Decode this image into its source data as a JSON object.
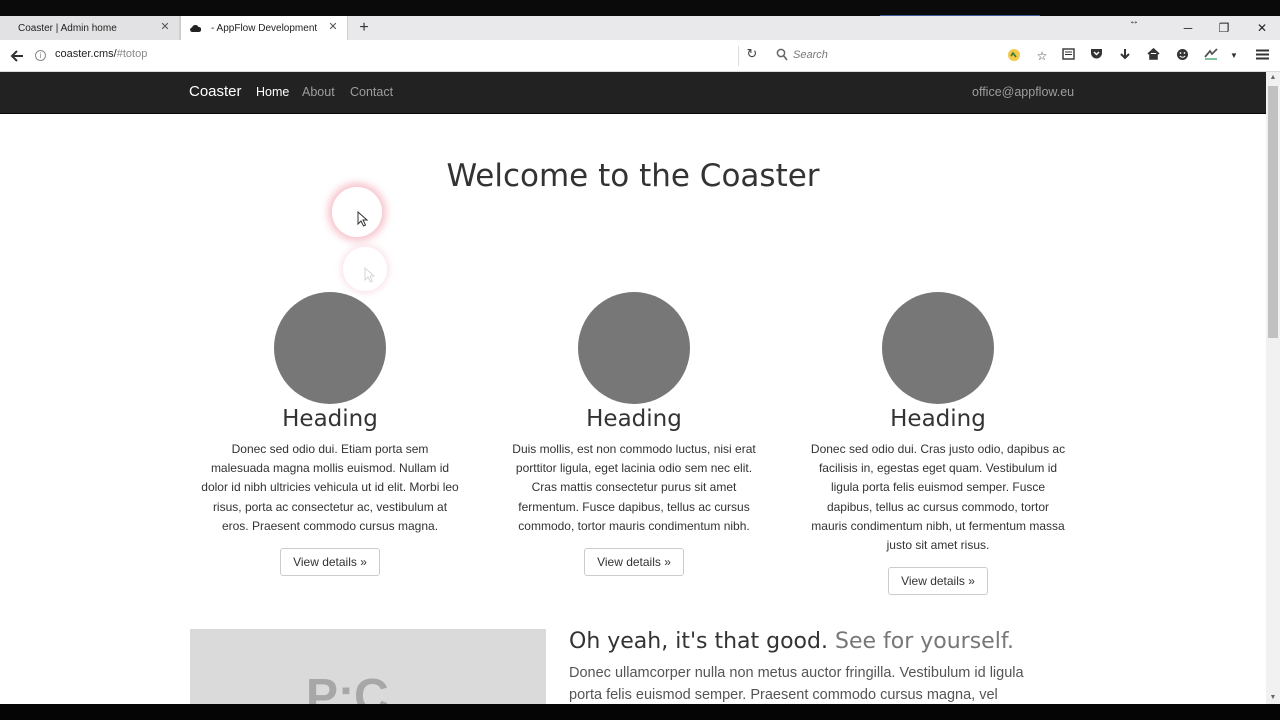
{
  "browser": {
    "tabs": [
      {
        "title": "Coaster | Admin home",
        "active": false
      },
      {
        "title": "- AppFlow Development",
        "active": true
      }
    ],
    "url": {
      "host": "coaster.cms/",
      "fragment": "#totop"
    },
    "search_placeholder": "Search",
    "icons": {
      "back": "back-arrow-icon",
      "reload": "reload-icon",
      "new_tab": "plus-icon",
      "toolbar": [
        "extension-icon",
        "bookmark-star-icon",
        "reading-list-icon",
        "pocket-icon",
        "download-icon",
        "home-icon",
        "smiley-icon",
        "extension-icon",
        "dropdown-icon",
        "menu-icon"
      ]
    }
  },
  "site": {
    "brand": "Coaster",
    "nav": [
      {
        "label": "Home",
        "active": true
      },
      {
        "label": "About",
        "active": false
      },
      {
        "label": "Contact",
        "active": false
      }
    ],
    "email": "office@appflow.eu",
    "hero_title": "Welcome to the Coaster",
    "columns": [
      {
        "heading": "Heading",
        "text": "Donec sed odio dui. Etiam porta sem malesuada magna mollis euismod. Nullam id dolor id nibh ultricies vehicula ut id elit. Morbi leo risus, porta ac consectetur ac, vestibulum at eros. Praesent commodo cursus magna.",
        "button": "View details »"
      },
      {
        "heading": "Heading",
        "text": "Duis mollis, est non commodo luctus, nisi erat porttitor ligula, eget lacinia odio sem nec elit. Cras mattis consectetur purus sit amet fermentum. Fusce dapibus, tellus ac cursus commodo, tortor mauris condimentum nibh.",
        "button": "View details »"
      },
      {
        "heading": "Heading",
        "text": "Donec sed odio dui. Cras justo odio, dapibus ac facilisis in, egestas eget quam. Vestibulum id ligula porta felis euismod semper. Fusce dapibus, tellus ac cursus commodo, tortor mauris condimentum nibh, ut fermentum massa justo sit amet risus.",
        "button": "View details »"
      }
    ],
    "featurette": {
      "heading": "Oh yeah, it's that good.",
      "heading_muted": "See for yourself.",
      "text": "Donec ullamcorper nulla non metus auctor fringilla. Vestibulum id ligula porta felis euismod semper. Praesent commodo cursus magna, vel",
      "image_text": "P:C"
    }
  }
}
